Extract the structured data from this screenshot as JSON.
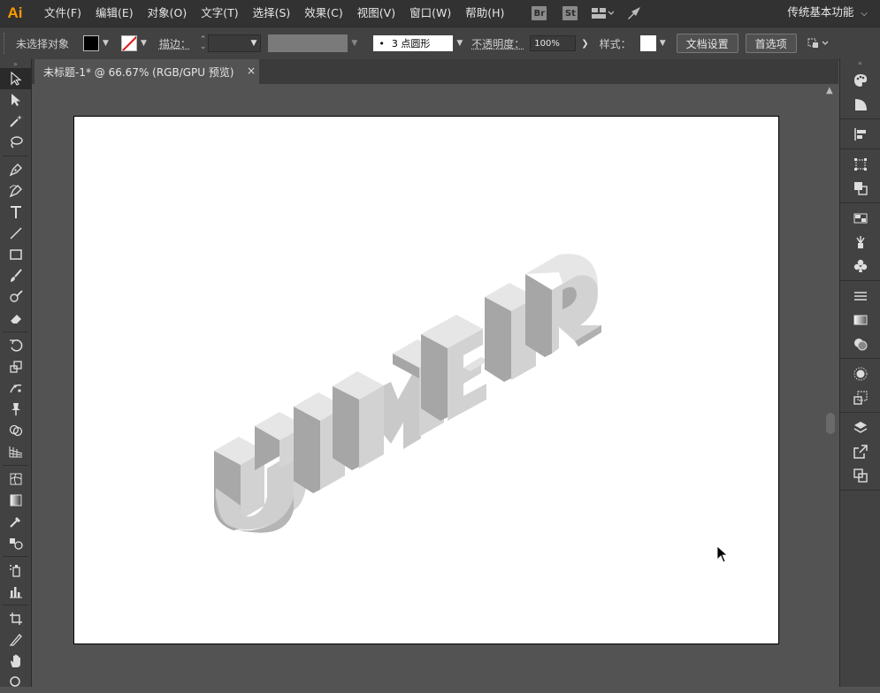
{
  "app": {
    "logo": "Ai"
  },
  "menu": [
    "文件(F)",
    "编辑(E)",
    "对象(O)",
    "文字(T)",
    "选择(S)",
    "效果(C)",
    "视图(V)",
    "窗口(W)",
    "帮助(H)"
  ],
  "menu_badges": [
    "Br",
    "St"
  ],
  "workspace": {
    "label": "传统基本功能"
  },
  "control_bar": {
    "selection_label": "未选择对象",
    "stroke_label": "描边：",
    "brush_size": "3",
    "brush_label": "点圆形",
    "opacity_label": "不透明度：",
    "opacity_value": "100%",
    "style_label": "样式：",
    "doc_setup": "文档设置",
    "preferences": "首选项"
  },
  "document_tab": {
    "title": "未标题-1* @ 66.67% (RGB/GPU 预览)",
    "close": "×"
  },
  "artwork": {
    "letters": [
      "U",
      "I",
      "M",
      "E",
      "I",
      "R"
    ],
    "face_color": "#d3d3d3",
    "side_color": "#a6a6a6",
    "top_color": "#e8e8e8"
  },
  "colors": {
    "logo": "#ff9a00",
    "menubar": "#323232",
    "panel": "#424242",
    "canvas": "#535353"
  }
}
